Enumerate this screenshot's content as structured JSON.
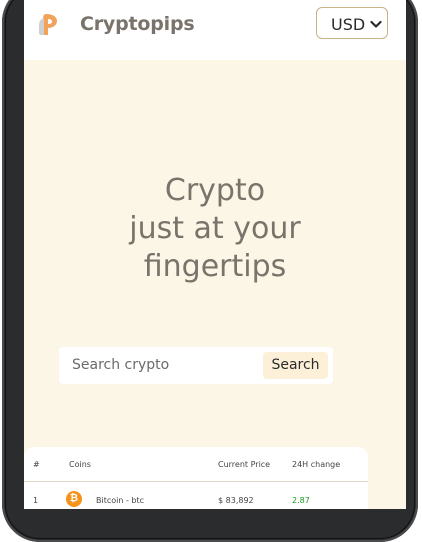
{
  "header": {
    "brand": "Cryptopips",
    "currency": {
      "selected": "USD"
    }
  },
  "hero": {
    "line1": "Crypto",
    "line2": "just at your",
    "line3": "fingertips"
  },
  "search": {
    "placeholder": "Search crypto",
    "button_label": "Search"
  },
  "table": {
    "headers": [
      "#",
      "Coins",
      "Current Price",
      "24H change"
    ],
    "rows": [
      {
        "rank": "1",
        "icon": "bitcoin-icon",
        "coin": "Bitcoin - btc",
        "price": "$ 83,892",
        "change": "2.87",
        "change_color": "#1f9a1f"
      }
    ]
  },
  "colors": {
    "page_bg": "#fcf6e6",
    "brand_text": "#7a736b",
    "accent_border": "#c9b388",
    "search_button_bg": "#fcf1d8",
    "bitcoin_orange": "#f7931a"
  }
}
